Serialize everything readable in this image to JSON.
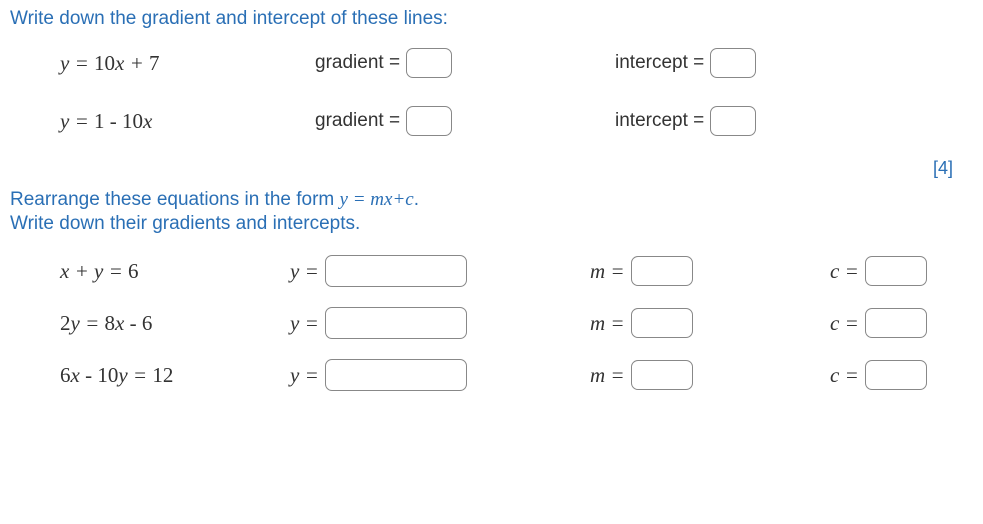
{
  "section1": {
    "instruction": "Write down the gradient and intercept of these lines:",
    "rows": [
      {
        "equation_html": "y = <span class='num'>10</span>x + <span class='num'>7</span>",
        "grad_label": "gradient =",
        "int_label": "intercept ="
      },
      {
        "equation_html": "y = <span class='num'>1 - 10</span>x",
        "grad_label": "gradient =",
        "int_label": "intercept ="
      }
    ]
  },
  "marks1": "[4]",
  "section2": {
    "instruction_line1": "Rearrange these equations in the form ",
    "instruction_math": "y = mx+c",
    "instruction_line1_end": ".",
    "instruction_line2": "Write down their gradients and intercepts.",
    "y_label": "y =",
    "m_label": "m =",
    "c_label": "c =",
    "rows": [
      {
        "equation_html": "x + y = <span class='num'>6</span>"
      },
      {
        "equation_html": "<span class='num'>2</span>y = <span class='num'>8</span>x - <span class='num'>6</span>"
      },
      {
        "equation_html": "<span class='num'>6</span>x - <span class='num'>10</span>y = <span class='num'>12</span>"
      }
    ]
  }
}
